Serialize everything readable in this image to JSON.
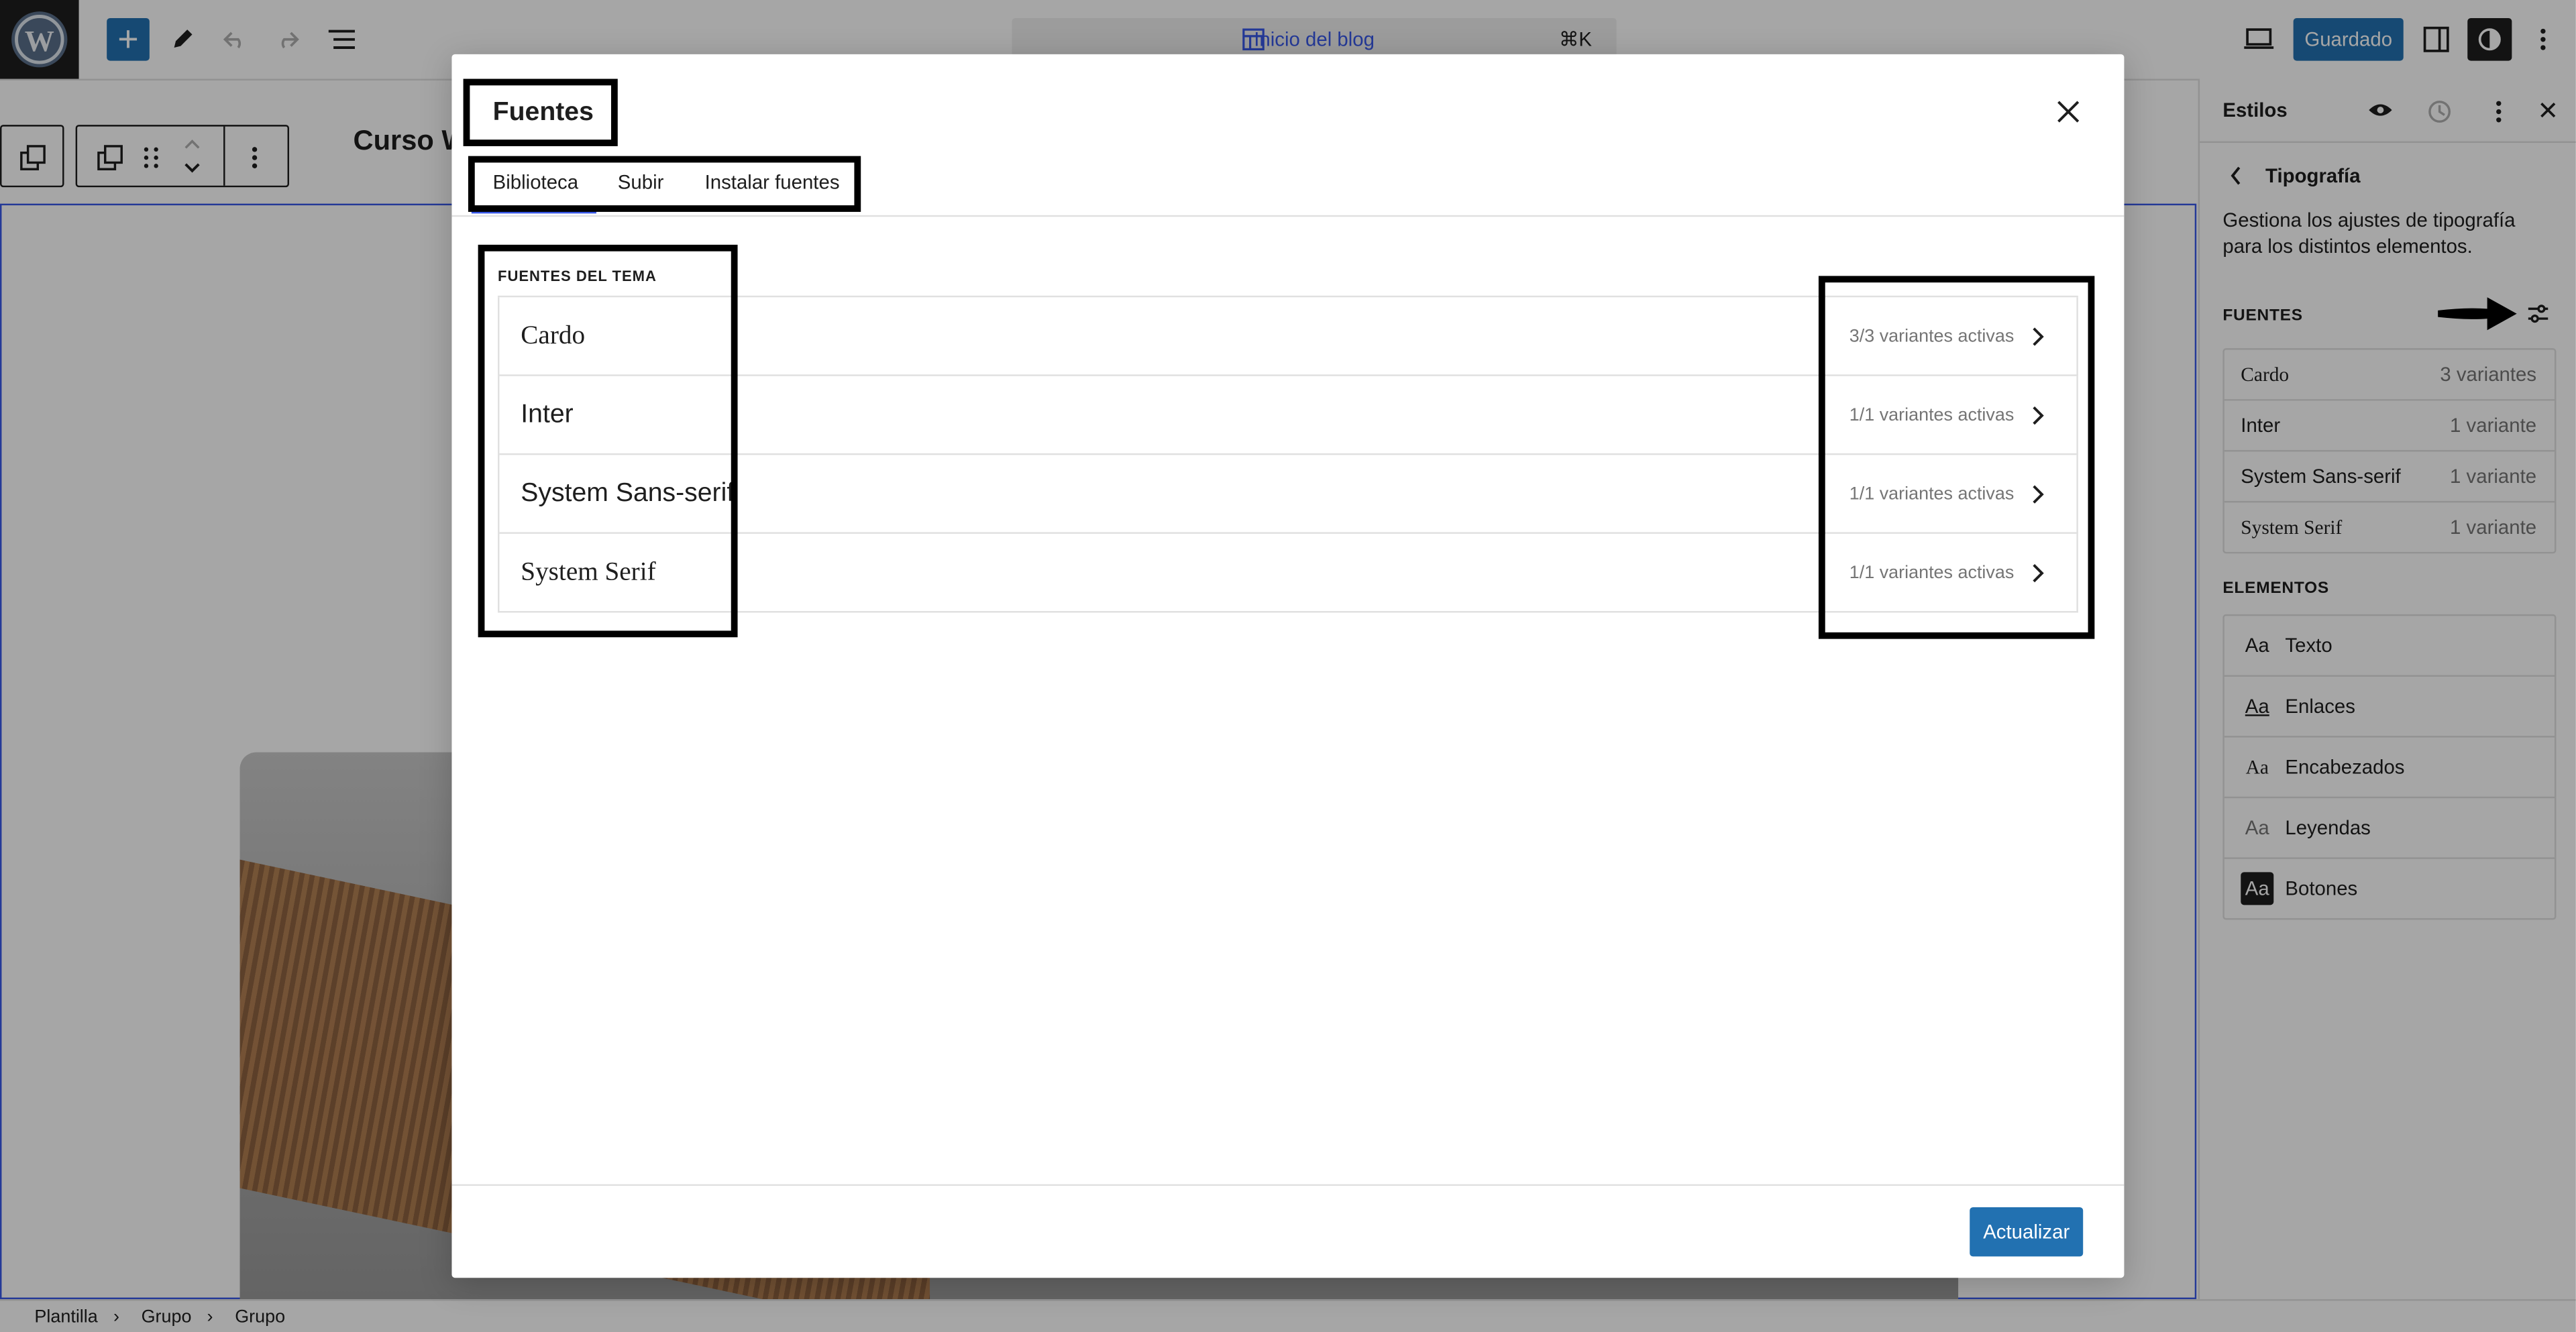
{
  "topbar": {
    "command_title": "Inicio del blog",
    "command_shortcut": "⌘K",
    "save_label": "Guardado"
  },
  "editor": {
    "site_title": "Curso W"
  },
  "breadcrumb": [
    "Plantilla",
    "Grupo",
    "Grupo"
  ],
  "sidebar": {
    "title": "Estilos",
    "section_title": "Tipografía",
    "description": "Gestiona los ajustes de tipografía para los distintos elementos.",
    "fonts_heading": "FUENTES",
    "fonts": [
      {
        "name": "Cardo",
        "count": "3 variantes"
      },
      {
        "name": "Inter",
        "count": "1 variante"
      },
      {
        "name": "System Sans-serif",
        "count": "1 variante"
      },
      {
        "name": "System Serif",
        "count": "1 variante"
      }
    ],
    "elements_heading": "ELEMENTOS",
    "elements": [
      {
        "aa": "Aa",
        "label": "Texto"
      },
      {
        "aa": "Aa",
        "label": "Enlaces"
      },
      {
        "aa": "Aa",
        "label": "Encabezados"
      },
      {
        "aa": "Aa",
        "label": "Leyendas"
      },
      {
        "aa": "Aa",
        "label": "Botones"
      }
    ]
  },
  "modal": {
    "title": "Fuentes",
    "tabs": [
      {
        "label": "Biblioteca",
        "active": true
      },
      {
        "label": "Subir",
        "active": false
      },
      {
        "label": "Instalar fuentes",
        "active": false
      }
    ],
    "theme_fonts_label": "FUENTES DEL TEMA",
    "fonts": [
      {
        "name": "Cardo",
        "variants": "3/3 variantes activas"
      },
      {
        "name": "Inter",
        "variants": "1/1 variantes activas"
      },
      {
        "name": "System Sans-serif",
        "variants": "1/1 variantes activas"
      },
      {
        "name": "System Serif",
        "variants": "1/1 variantes activas"
      }
    ],
    "update_label": "Actualizar"
  },
  "colors": {
    "accent": "#3858e9",
    "primary_button": "#2271b1",
    "overlay": "rgba(0,0,0,0.35)"
  },
  "icons": [
    "wordpress-logo-icon",
    "plus-icon",
    "pen-icon",
    "undo-icon",
    "redo-icon",
    "list-view-icon",
    "template-icon",
    "desktop-view-icon",
    "sidebar-toggle-icon",
    "styles-contrast-icon",
    "more-vertical-icon",
    "close-icon",
    "eye-icon",
    "revisions-icon",
    "chevron-left-icon",
    "chevron-right-icon",
    "adjustments-icon",
    "arrow-annotation-icon"
  ]
}
